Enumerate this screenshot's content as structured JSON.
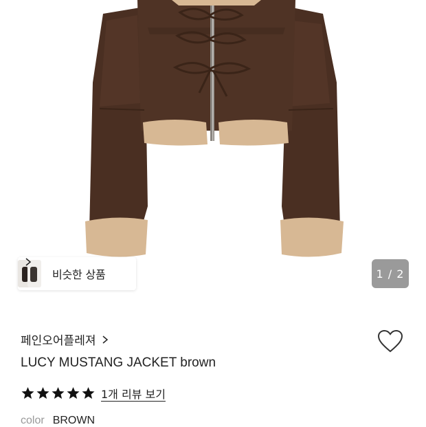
{
  "gallery": {
    "image_alt": "brown leather cropped jacket with shearling cuffs",
    "counter": "1 / 2"
  },
  "similar": {
    "label": "비슷한 상품"
  },
  "product": {
    "brand": "페인오어플레져",
    "title": "LUCY MUSTANG JACKET brown",
    "rating_stars": 5,
    "review_link": "1개 리뷰 보기",
    "color_label": "color",
    "color_value": "BROWN"
  },
  "colors": {
    "leather": "#4a2f22",
    "leather_light": "#6a4737",
    "shearling": "#d7b894",
    "counter_bg": "#9a9a9a"
  },
  "icons": {
    "wishlist": "heart-outline-icon",
    "brand_link": "chevron-right-icon",
    "similar_link": "chevron-right-icon",
    "rating": "star-icon"
  }
}
